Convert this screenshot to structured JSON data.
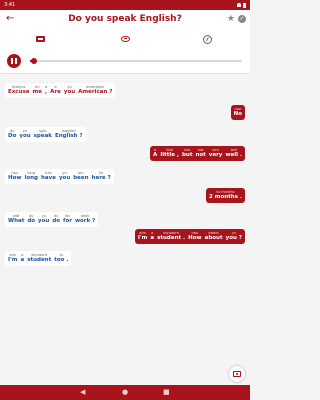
{
  "status_bar": {
    "time": "3:41"
  },
  "header": {
    "title": "Do you speak English?",
    "back_icon": "arrow-back-icon",
    "star_icon": "star-icon",
    "check_icon": "check-circle-icon"
  },
  "toolbar": {
    "icons": [
      "translation-box-icon",
      "speech-bubble-icon",
      "speed-gauge-icon"
    ]
  },
  "player": {
    "progress": 0.02,
    "pause_icon": "pause-icon"
  },
  "colors": {
    "accent": "#a8141c",
    "english_text": "#1d4fa0",
    "background": "#f4f4f4"
  },
  "messages": [
    {
      "side": "left",
      "highlight": true,
      "words": [
        {
          "pron": "ikskyus",
          "text": "Excuse"
        },
        {
          "pron": "mi",
          "text": "me"
        },
        {
          "pron": "a",
          "text": ","
        },
        {
          "pron": "a",
          "text": "Are"
        },
        {
          "pron": "yu",
          "text": "you"
        },
        {
          "pron": "amerakan",
          "text": "American ?"
        }
      ]
    },
    {
      "side": "right",
      "words": [
        {
          "pron": "noo",
          "text": "No"
        }
      ]
    },
    {
      "side": "left",
      "words": [
        {
          "pron": "du",
          "text": "Do"
        },
        {
          "pron": "yu",
          "text": "you"
        },
        {
          "pron": "spik",
          "text": "speak"
        },
        {
          "pron": "ingglish",
          "text": "English ?"
        }
      ]
    },
    {
      "side": "right",
      "words": [
        {
          "pron": "a",
          "text": "A"
        },
        {
          "pron": "lital",
          "text": "little ,"
        },
        {
          "pron": "bat",
          "text": "but"
        },
        {
          "pron": "nat",
          "text": "not"
        },
        {
          "pron": "veri",
          "text": "very"
        },
        {
          "pron": "wel",
          "text": "well ."
        }
      ]
    },
    {
      "side": "left",
      "words": [
        {
          "pron": "hau",
          "text": "How"
        },
        {
          "pron": "lang",
          "text": "long"
        },
        {
          "pron": "hav",
          "text": "have"
        },
        {
          "pron": "yu",
          "text": "you"
        },
        {
          "pron": "bin",
          "text": "been"
        },
        {
          "pron": "hir",
          "text": "here ?"
        }
      ]
    },
    {
      "side": "right",
      "words": [
        {
          "pron": "tu manths",
          "text": "2 months ."
        }
      ]
    },
    {
      "side": "left",
      "words": [
        {
          "pron": "wat",
          "text": "What"
        },
        {
          "pron": "du",
          "text": "do"
        },
        {
          "pron": "yu",
          "text": "you"
        },
        {
          "pron": "du",
          "text": "do"
        },
        {
          "pron": "far",
          "text": "for"
        },
        {
          "pron": "wark",
          "text": "work ?"
        }
      ]
    },
    {
      "side": "right",
      "words": [
        {
          "pron": "aim",
          "text": "I'm"
        },
        {
          "pron": "a",
          "text": "a"
        },
        {
          "pron": "styudant",
          "text": "student ."
        },
        {
          "pron": "hau",
          "text": "How"
        },
        {
          "pron": "abaut",
          "text": "about"
        },
        {
          "pron": "yu",
          "text": "you ?"
        }
      ]
    },
    {
      "side": "left",
      "words": [
        {
          "pron": "aim",
          "text": "I'm"
        },
        {
          "pron": "a",
          "text": "a"
        },
        {
          "pron": "styudant",
          "text": "student"
        },
        {
          "pron": "tu",
          "text": "too ."
        }
      ]
    }
  ],
  "fab": {
    "icon": "camera-icon"
  },
  "nav_bar": {
    "back": "◀",
    "home": "●",
    "recents": "■"
  }
}
